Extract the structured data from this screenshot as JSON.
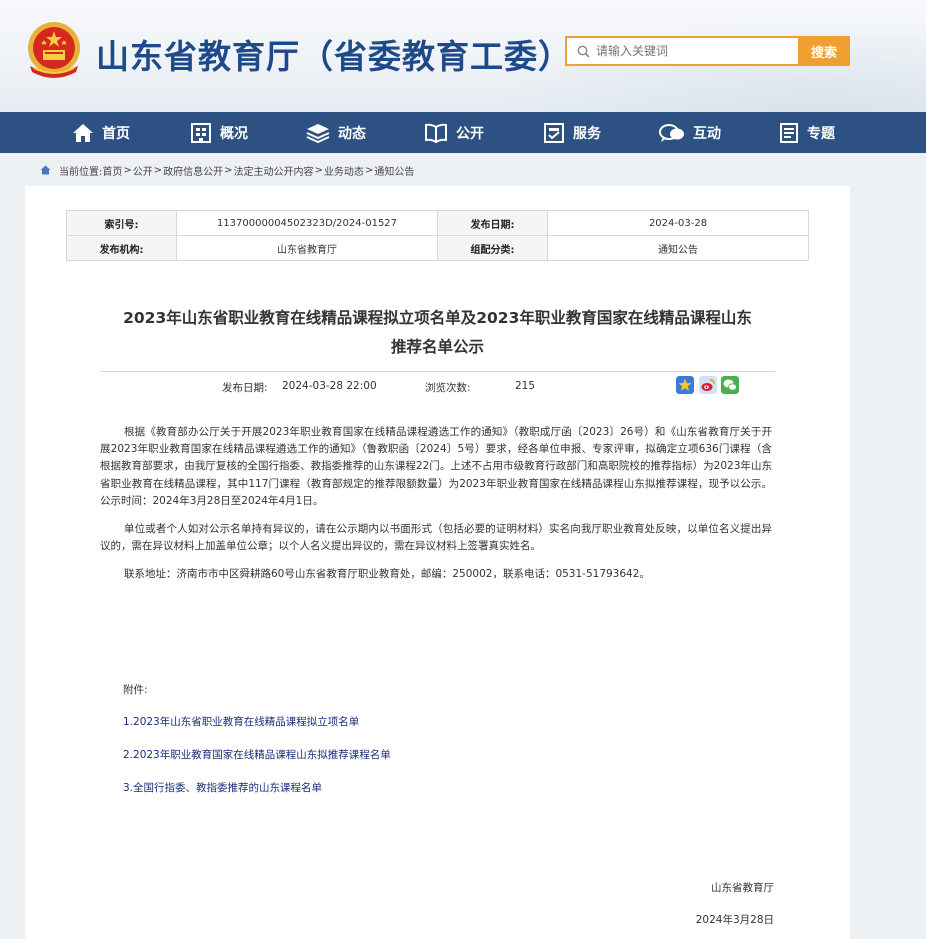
{
  "header": {
    "site_title": "山东省教育厅（省委教育工委）",
    "search_placeholder": "请输入关键词",
    "search_button": "搜索"
  },
  "nav": {
    "items": [
      {
        "label": "首页",
        "icon": "home-icon"
      },
      {
        "label": "概况",
        "icon": "building-icon"
      },
      {
        "label": "动态",
        "icon": "layers-icon"
      },
      {
        "label": "公开",
        "icon": "book-icon"
      },
      {
        "label": "服务",
        "icon": "service-icon"
      },
      {
        "label": "互动",
        "icon": "chat-icon"
      },
      {
        "label": "专题",
        "icon": "document-icon"
      }
    ]
  },
  "breadcrumb": {
    "prefix": "当前位置:",
    "items": [
      "首页",
      "公开",
      "政府信息公开",
      "法定主动公开内容",
      "业务动态",
      "通知公告"
    ]
  },
  "meta": {
    "index_label": "索引号:",
    "index_value": "11370000004502323D/2024-01527",
    "date_label": "发布日期:",
    "date_value": "2024-03-28",
    "org_label": "发布机构:",
    "org_value": "山东省教育厅",
    "category_label": "组配分类:",
    "category_value": "通知公告"
  },
  "article": {
    "title_line1": "2023年山东省职业教育在线精品课程拟立项名单及2023年职业教育国家在线精品课程山东",
    "title_line2": "推荐名单公示",
    "pub_date_label": "发布日期:",
    "pub_date_value": "2024-03-28 22:00",
    "views_label": "浏览次数:",
    "views_value": "215",
    "paragraphs": [
      "根据《教育部办公厅关于开展2023年职业教育国家在线精品课程遴选工作的通知》（教职成厅函〔2023〕26号）和《山东省教育厅关于开展2023年职业教育国家在线精品课程遴选工作的通知》（鲁教职函〔2024〕5号）要求，经各单位申报、专家评审，拟确定立项636门课程（含根据教育部要求，由我厅复核的全国行指委、教指委推荐的山东课程22门。上述不占用市级教育行政部门和高职院校的推荐指标）为2023年山东省职业教育在线精品课程，其中117门课程（教育部规定的推荐限额数量）为2023年职业教育国家在线精品课程山东拟推荐课程，现予以公示。公示时间：2024年3月28日至2024年4月1日。",
      "单位或者个人如对公示名单持有异议的，请在公示期内以书面形式（包括必要的证明材料）实名向我厅职业教育处反映，以单位名义提出异议的，需在异议材料上加盖单位公章；以个人名义提出异议的，需在异议材料上签署真实姓名。",
      "联系地址：济南市市中区舜耕路60号山东省教育厅职业教育处，邮编：250002，联系电话：0531-51793642。"
    ],
    "attachments_label": "附件:",
    "attachments": [
      "1.2023年山东省职业教育在线精品课程拟立项名单",
      "2.2023年职业教育国家在线精品课程山东拟推荐课程名单",
      "3.全国行指委、教指委推荐的山东课程名单"
    ],
    "signature": "山东省教育厅",
    "sign_date": "2024年3月28日"
  },
  "colors": {
    "nav_bg": "#2e5183",
    "title_blue": "#1f4a8a",
    "search_orange": "#f0a030",
    "link": "#1a2e7a"
  }
}
